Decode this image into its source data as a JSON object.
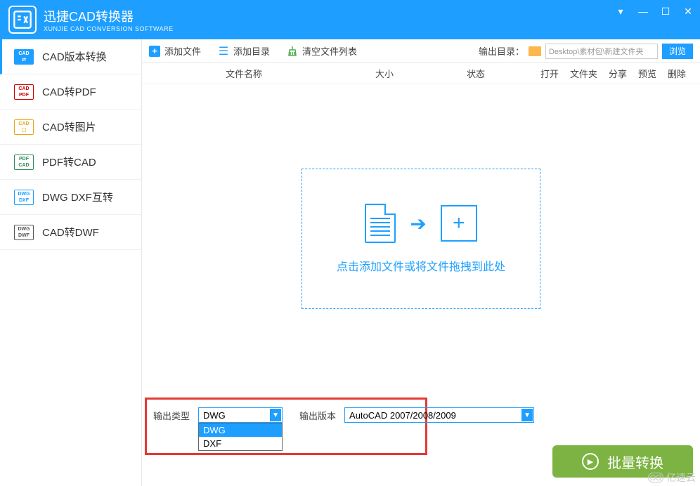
{
  "app": {
    "title": "迅捷CAD转换器",
    "subtitle": "XUNJIE CAD CONVERSION SOFTWARE"
  },
  "sidebar": {
    "items": [
      {
        "label": "CAD版本转换",
        "t1": "CAD",
        "t2": "⇄"
      },
      {
        "label": "CAD转PDF",
        "t1": "CAD",
        "t2": "PDF"
      },
      {
        "label": "CAD转图片",
        "t1": "CAD",
        "t2": "⬚"
      },
      {
        "label": "PDF转CAD",
        "t1": "PDF",
        "t2": "CAD"
      },
      {
        "label": "DWG DXF互转",
        "t1": "DWG",
        "t2": "DXF"
      },
      {
        "label": "CAD转DWF",
        "t1": "DWG",
        "t2": "DWF"
      }
    ]
  },
  "toolbar": {
    "add_file": "添加文件",
    "add_dir": "添加目录",
    "clear": "清空文件列表",
    "out_dir_label": "输出目录：",
    "out_dir_value": "Desktop\\素材包\\新建文件夹",
    "browse": "浏览"
  },
  "table": {
    "name": "文件名称",
    "size": "大小",
    "status": "状态",
    "open": "打开",
    "folder": "文件夹",
    "share": "分享",
    "preview": "预览",
    "delete": "删除"
  },
  "dropzone": {
    "text": "点击添加文件或将文件拖拽到此处"
  },
  "options": {
    "type_label": "输出类型",
    "type_value": "DWG",
    "type_options": [
      "DWG",
      "DXF"
    ],
    "version_label": "输出版本",
    "version_value": "AutoCAD 2007/2008/2009"
  },
  "convert_btn": "批量转换",
  "watermark": "亿速云"
}
